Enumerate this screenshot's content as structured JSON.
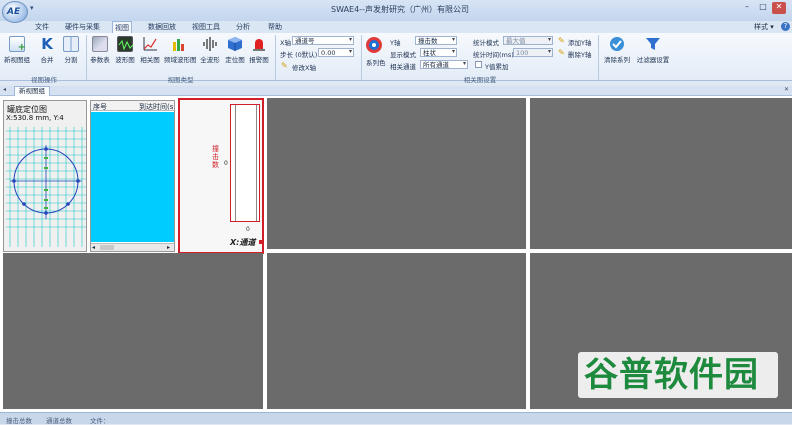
{
  "window": {
    "title": "SWAE4--声发射研究（广州）有限公司",
    "app_logo_text": "AE",
    "quick_access": "▾",
    "style_menu": "样式 ▾",
    "help_glyph": "?"
  },
  "menu_tabs": [
    "文件",
    "硬件与采集",
    "视图",
    "数据回放",
    "视图工具",
    "分析",
    "帮助"
  ],
  "active_tab": "视图",
  "ribbon": {
    "group_view_ops": {
      "label": "视图操作",
      "buttons": [
        "新视图组",
        "合并",
        "分割"
      ]
    },
    "group_view_types": {
      "label": "视图类型",
      "buttons": [
        "参数表",
        "波形图",
        "相关图",
        "频域波形图",
        "全波形",
        "定位图",
        "报警图"
      ]
    },
    "group_axis": {
      "x_axis_label": "X轴",
      "x_axis_value": "通道号",
      "step_label": "步长 (0默认)",
      "step_value": "0.00",
      "modify_x_label": "修改X轴"
    },
    "group_corr": {
      "label": "相关图设置",
      "series_color_label": "系列色",
      "y_axis_label": "Y轴",
      "y_axis_value": "撞击数",
      "display_mode_label": "显示模式",
      "display_mode_value": "柱状",
      "corr_channel_label": "相关通道",
      "corr_channel_value": "所有通道",
      "stat_mode_label": "统计模式",
      "stat_mode_value": "最大值",
      "stat_time_label": "统计时间(ms)",
      "stat_time_value": "100",
      "y_overlay_label": "Y值累加",
      "add_y_label": "添加Y轴",
      "del_y_label": "删除Y轴"
    },
    "clear_series_label": "清除系列",
    "filter_settings_label": "过滤器设置"
  },
  "doc_tab": "新视图组",
  "views": {
    "location": {
      "title": "罐底定位图",
      "coords": "X:530.8 mm, Y:4"
    },
    "param_table": {
      "col1": "序号",
      "col2": "到达时间(s"
    },
    "correlation": {
      "y_title": "撞击数",
      "y_tick": "0",
      "x_tick": "0",
      "x_title": "X:通道"
    }
  },
  "status": {
    "hits": "撞击总数",
    "channels": "通道总数",
    "file": "文件："
  },
  "watermark": "谷普软件园",
  "colors": {
    "panel_gray": "#6b6b6b",
    "cyan": "#00ccff",
    "grid": "#1fc6c6",
    "red_border": "#d11f2a"
  }
}
